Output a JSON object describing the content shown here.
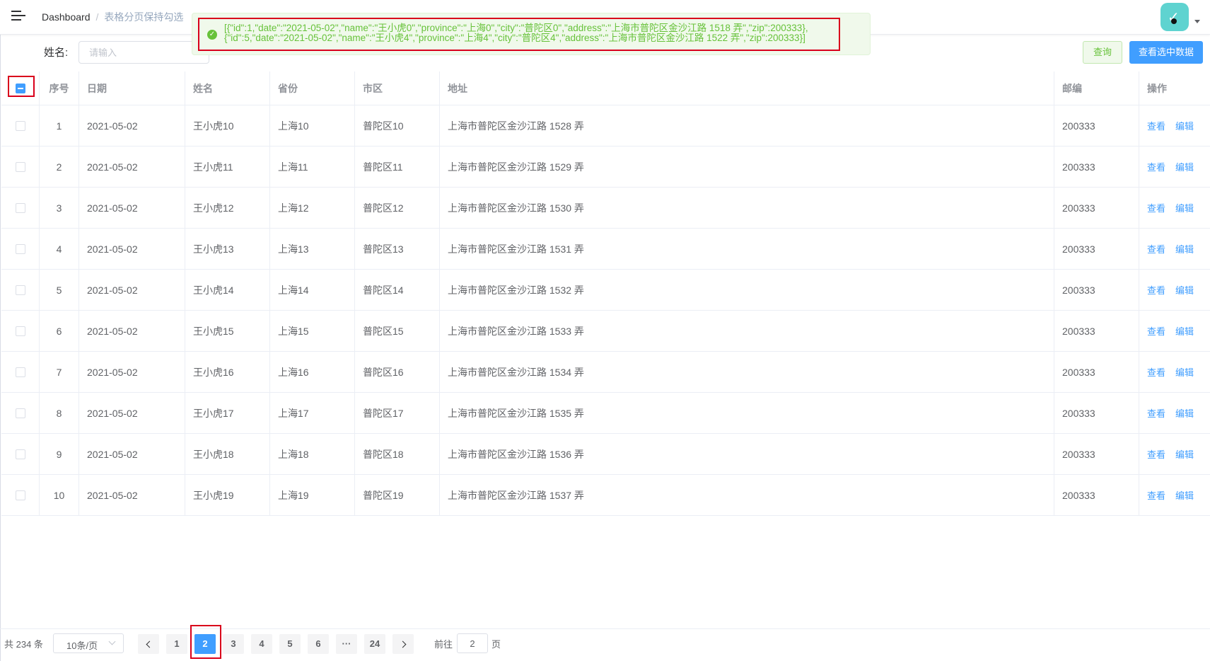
{
  "navbar": {
    "breadcrumb_home": "Dashboard",
    "breadcrumb_separator": "/",
    "breadcrumb_current": "表格分页保持勾选"
  },
  "message": {
    "type": "success",
    "line1": "[{\"id\":1,\"date\":\"2021-05-02\",\"name\":\"王小虎0\",\"province\":\"上海0\",\"city\":\"普陀区0\",\"address\":\"上海市普陀区金沙江路 1518 弄\",\"zip\":200333},",
    "line2": "{\"id\":5,\"date\":\"2021-05-02\",\"name\":\"王小虎4\",\"province\":\"上海4\",\"city\":\"普陀区4\",\"address\":\"上海市普陀区金沙江路 1522 弄\",\"zip\":200333}]"
  },
  "search": {
    "label": "姓名:",
    "placeholder": "请输入",
    "query_button": "查询",
    "view_selected_button": "查看选中数据"
  },
  "table": {
    "headers": {
      "index": "序号",
      "date": "日期",
      "name": "姓名",
      "province": "省份",
      "city": "市区",
      "address": "地址",
      "zip": "邮编",
      "ops": "操作"
    },
    "select_all_state": "indeterminate",
    "view_label": "查看",
    "edit_label": "编辑",
    "rows": [
      {
        "index": "1",
        "date": "2021-05-02",
        "name": "王小虎10",
        "province": "上海10",
        "city": "普陀区10",
        "address": "上海市普陀区金沙江路 1528 弄",
        "zip": "200333",
        "checked": false
      },
      {
        "index": "2",
        "date": "2021-05-02",
        "name": "王小虎11",
        "province": "上海11",
        "city": "普陀区11",
        "address": "上海市普陀区金沙江路 1529 弄",
        "zip": "200333",
        "checked": false
      },
      {
        "index": "3",
        "date": "2021-05-02",
        "name": "王小虎12",
        "province": "上海12",
        "city": "普陀区12",
        "address": "上海市普陀区金沙江路 1530 弄",
        "zip": "200333",
        "checked": false
      },
      {
        "index": "4",
        "date": "2021-05-02",
        "name": "王小虎13",
        "province": "上海13",
        "city": "普陀区13",
        "address": "上海市普陀区金沙江路 1531 弄",
        "zip": "200333",
        "checked": false
      },
      {
        "index": "5",
        "date": "2021-05-02",
        "name": "王小虎14",
        "province": "上海14",
        "city": "普陀区14",
        "address": "上海市普陀区金沙江路 1532 弄",
        "zip": "200333",
        "checked": false
      },
      {
        "index": "6",
        "date": "2021-05-02",
        "name": "王小虎15",
        "province": "上海15",
        "city": "普陀区15",
        "address": "上海市普陀区金沙江路 1533 弄",
        "zip": "200333",
        "checked": false
      },
      {
        "index": "7",
        "date": "2021-05-02",
        "name": "王小虎16",
        "province": "上海16",
        "city": "普陀区16",
        "address": "上海市普陀区金沙江路 1534 弄",
        "zip": "200333",
        "checked": false
      },
      {
        "index": "8",
        "date": "2021-05-02",
        "name": "王小虎17",
        "province": "上海17",
        "city": "普陀区17",
        "address": "上海市普陀区金沙江路 1535 弄",
        "zip": "200333",
        "checked": false
      },
      {
        "index": "9",
        "date": "2021-05-02",
        "name": "王小虎18",
        "province": "上海18",
        "city": "普陀区18",
        "address": "上海市普陀区金沙江路 1536 弄",
        "zip": "200333",
        "checked": false
      },
      {
        "index": "10",
        "date": "2021-05-02",
        "name": "王小虎19",
        "province": "上海19",
        "city": "普陀区19",
        "address": "上海市普陀区金沙江路 1537 弄",
        "zip": "200333",
        "checked": false
      }
    ]
  },
  "pagination": {
    "total_text": "共 234 条",
    "page_size": "10条/页",
    "pages": [
      "1",
      "2",
      "3",
      "4",
      "5",
      "6",
      "···",
      "24"
    ],
    "current_page": "2",
    "goto_prefix": "前往",
    "goto_value": "2",
    "goto_suffix": "页"
  },
  "colors": {
    "primary": "#409eff",
    "success": "#67c23a",
    "highlight_box": "#d9001b",
    "avatar_bg": "#5fd3d0"
  },
  "icons": [
    "hamburger-icon",
    "success-circle-icon",
    "avatar-icon",
    "caret-down-icon",
    "chevron-left-icon",
    "chevron-right-icon",
    "dropdown-arrow-icon"
  ]
}
